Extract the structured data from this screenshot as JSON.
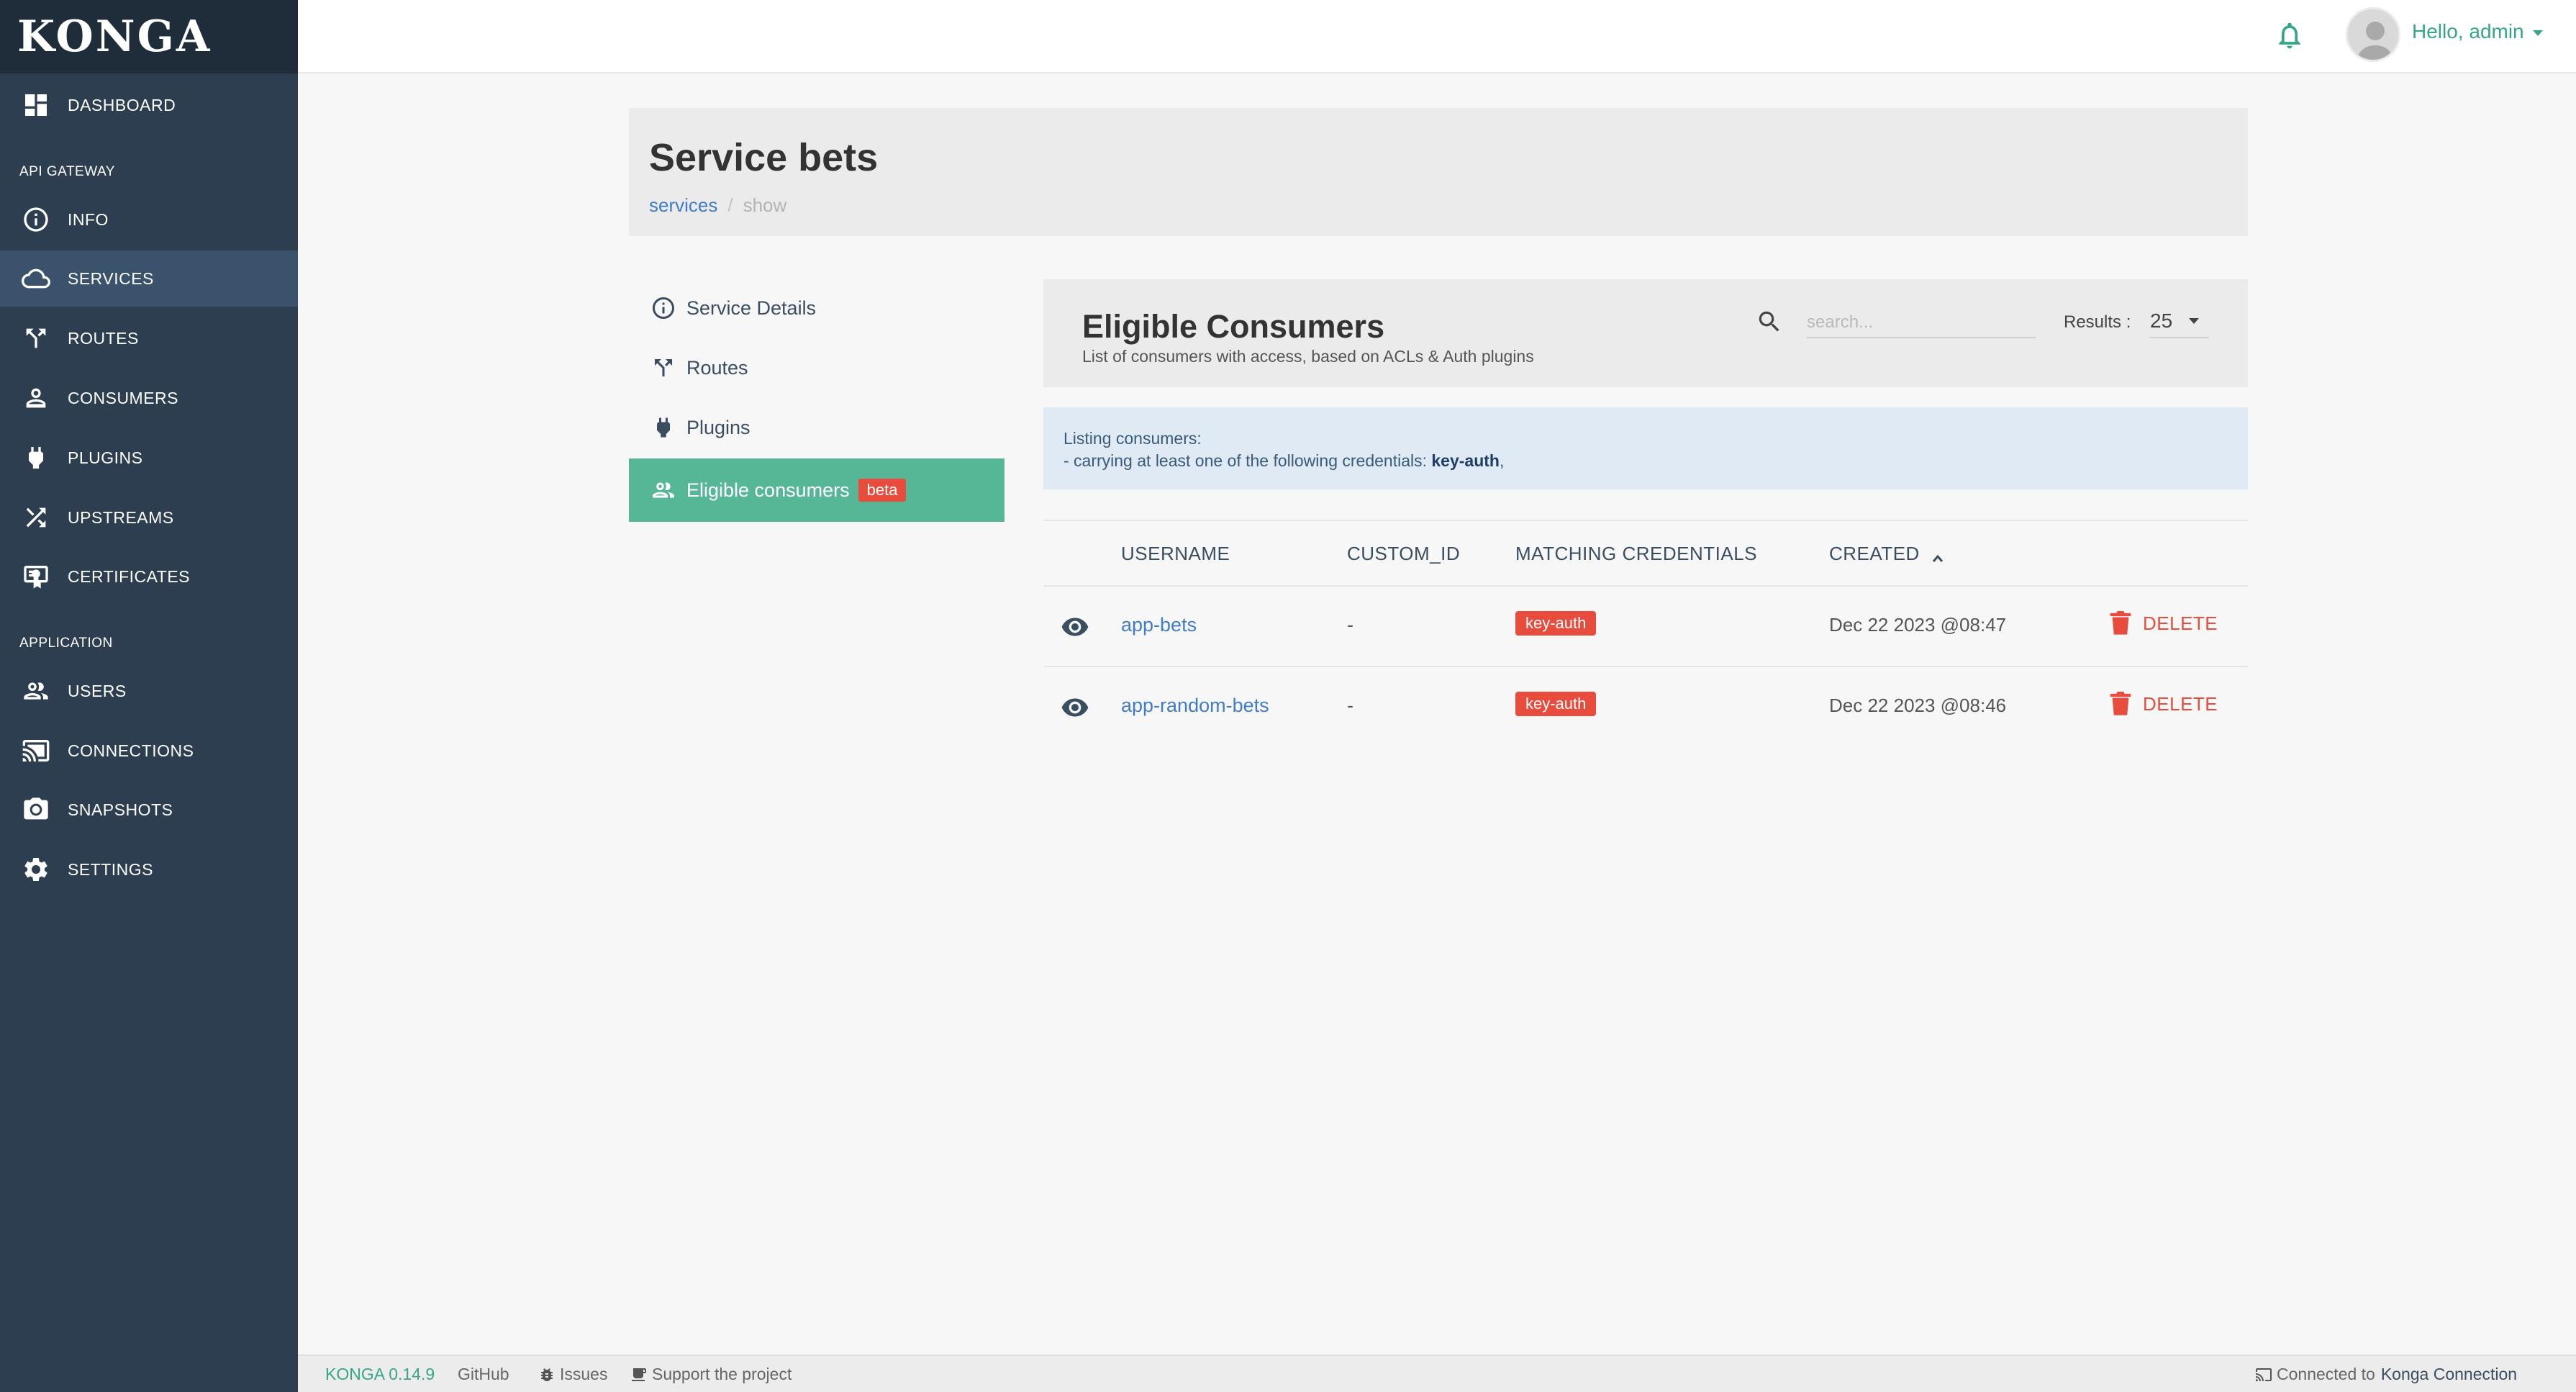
{
  "app": {
    "logo": "KONGA"
  },
  "sidebar": {
    "items": [
      {
        "label": "DASHBOARD",
        "icon": "dashboard-icon"
      },
      {
        "label": "INFO",
        "icon": "info-icon"
      },
      {
        "label": "SERVICES",
        "icon": "cloud-icon",
        "active": true
      },
      {
        "label": "ROUTES",
        "icon": "routes-icon"
      },
      {
        "label": "CONSUMERS",
        "icon": "user-icon"
      },
      {
        "label": "PLUGINS",
        "icon": "plug-icon"
      },
      {
        "label": "UPSTREAMS",
        "icon": "shuffle-icon"
      },
      {
        "label": "CERTIFICATES",
        "icon": "certificate-icon"
      },
      {
        "label": "USERS",
        "icon": "users-icon"
      },
      {
        "label": "CONNECTIONS",
        "icon": "cast-icon"
      },
      {
        "label": "SNAPSHOTS",
        "icon": "camera-icon"
      },
      {
        "label": "SETTINGS",
        "icon": "gear-icon"
      }
    ],
    "sections": {
      "api_gateway": "API GATEWAY",
      "application": "APPLICATION"
    }
  },
  "topbar": {
    "greeting": "Hello, admin"
  },
  "page": {
    "title": "Service bets",
    "breadcrumb": {
      "link": "services",
      "separator": "/",
      "current": "show"
    }
  },
  "side_menu": {
    "items": [
      {
        "label": "Service Details",
        "icon": "info-icon"
      },
      {
        "label": "Routes",
        "icon": "routes-icon"
      },
      {
        "label": "Plugins",
        "icon": "plug-icon"
      },
      {
        "label": "Eligible consumers",
        "icon": "users-icon",
        "badge": "beta",
        "active": true
      }
    ]
  },
  "panel": {
    "title": "Eligible Consumers",
    "subtitle": "List of consumers with access, based on ACLs & Auth plugins",
    "search_placeholder": "search...",
    "results_label": "Results :",
    "results_value": "25"
  },
  "info": {
    "line1": "Listing consumers:",
    "line2_prefix": "- carrying at least one of the following credentials:",
    "line2_credential": "key-auth",
    "line2_suffix": ","
  },
  "table": {
    "columns": [
      "USERNAME",
      "CUSTOM_ID",
      "MATCHING CREDENTIALS",
      "CREATED"
    ],
    "delete_label": "DELETE",
    "rows": [
      {
        "username": "app-bets",
        "custom_id": "-",
        "credential": "key-auth",
        "created": "Dec 22 2023 @08:47"
      },
      {
        "username": "app-random-bets",
        "custom_id": "-",
        "credential": "key-auth",
        "created": "Dec 22 2023 @08:46"
      }
    ]
  },
  "footer": {
    "version": "KONGA 0.14.9",
    "github": "GitHub",
    "issues": "Issues",
    "support": "Support the project",
    "connected_prefix": "Connected to",
    "connection_name": "Konga Connection"
  },
  "colors": {
    "sidebar_bg": "#2c3e50",
    "sidebar_active": "#3a526b",
    "accent_green": "#56b797",
    "brand_green": "#35a68b",
    "danger_red": "#e74c3c",
    "link_blue": "#3f7dc8",
    "info_bg": "#dfeaf4"
  }
}
